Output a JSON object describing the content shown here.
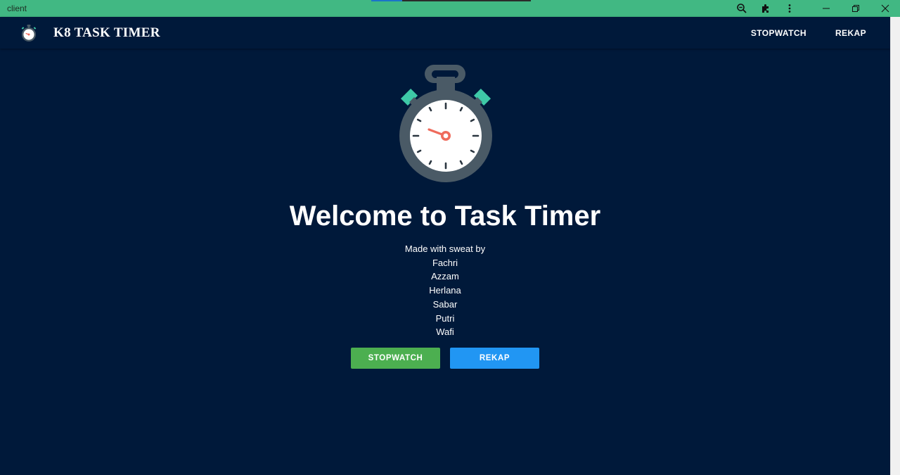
{
  "window": {
    "title": "client",
    "icons": [
      "zoom-out-icon",
      "extension-icon",
      "more-vert-icon"
    ],
    "controls": [
      "minimize-icon",
      "restore-icon",
      "close-icon"
    ],
    "chrome_color": "#41b883"
  },
  "header": {
    "app_name": "K8 TASK TIMER",
    "nav": [
      {
        "label": "STOPWATCH"
      },
      {
        "label": "REKAP"
      }
    ],
    "bg_color": "#00193a"
  },
  "main": {
    "headline": "Welcome to Task Timer",
    "credits_intro": "Made with sweat by",
    "credits": [
      "Fachri",
      "Azzam",
      "Herlana",
      "Sabar",
      "Putri",
      "Wafi"
    ],
    "buttons": {
      "stopwatch": {
        "label": "STOPWATCH",
        "color": "#4caf50"
      },
      "rekap": {
        "label": "REKAP",
        "color": "#2196f3"
      }
    }
  }
}
